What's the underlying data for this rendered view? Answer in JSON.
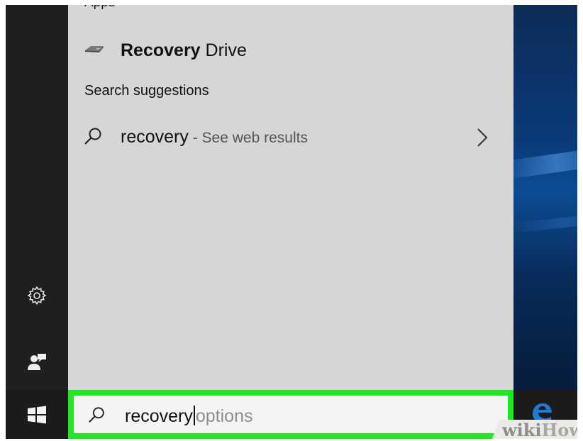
{
  "start_menu": {
    "apps_heading": "Apps",
    "app_result": {
      "name_bold": "Recovery",
      "name_rest": " Drive",
      "icon": "drive-icon"
    },
    "suggestions_heading": "Search suggestions",
    "suggestion": {
      "query": "recovery",
      "suffix": " - See web results",
      "icon": "search-icon",
      "action_icon": "chevron-right-icon"
    }
  },
  "left_rail": {
    "settings_icon": "gear-icon",
    "feedback_icon": "feedback-icon"
  },
  "taskbar": {
    "start_icon": "windows-logo-icon",
    "search": {
      "typed_text": "recovery",
      "autocomplete_text": "options",
      "icon": "search-icon"
    },
    "pinned": [
      {
        "name": "Microsoft Edge",
        "icon": "edge-icon"
      }
    ]
  },
  "watermark": {
    "part1": "wiki",
    "part2": "How"
  },
  "colors": {
    "highlight": "#22e622",
    "panel_bg": "#d6d6d6",
    "rail_bg": "#1f1f1f",
    "taskbar_bg": "#1b1b1b"
  }
}
